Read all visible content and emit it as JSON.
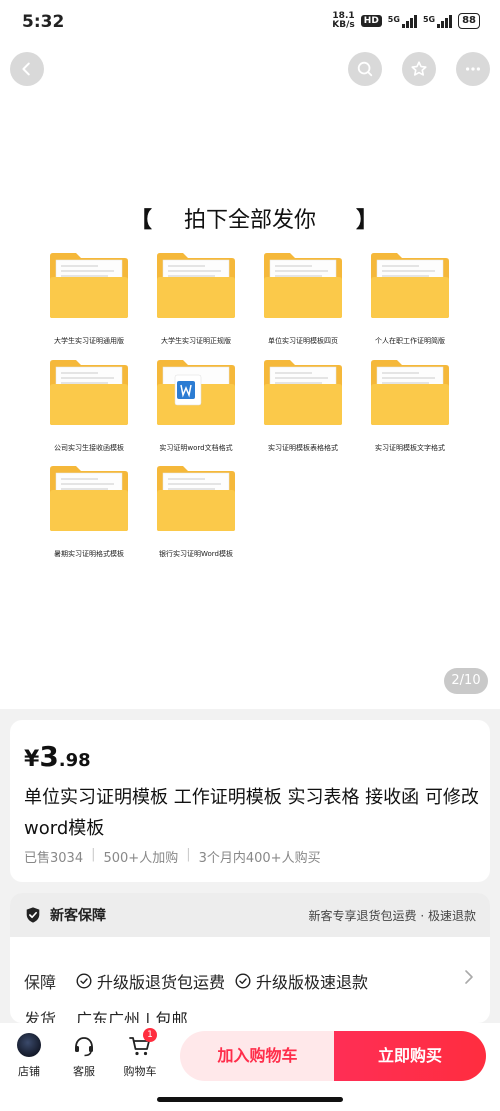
{
  "status_bar": {
    "time": "5:32",
    "net_speed_value": "18.1",
    "net_speed_unit": "KB/s",
    "hd_label": "HD",
    "signal_1": "5G",
    "signal_2": "5G",
    "battery": "88"
  },
  "gallery": {
    "headline": "拍下全部发你",
    "bracket_left": "【",
    "bracket_right": "】",
    "page_indicator": "2/10",
    "folders": [
      {
        "label": "大学生实习证明通用版"
      },
      {
        "label": "大学生实习证明正规版"
      },
      {
        "label": "单位实习证明模板四页"
      },
      {
        "label": "个人在职工作证明简版"
      },
      {
        "label": "公司实习生接收函模板"
      },
      {
        "label": "实习证明word文档格式"
      },
      {
        "label": "实习证明模板表格格式"
      },
      {
        "label": "实习证明模板文字格式"
      },
      {
        "label": "暑期实习证明格式模板"
      },
      {
        "label": "银行实习证明Word模板"
      }
    ]
  },
  "product": {
    "currency": "¥",
    "price_int": "3",
    "price_dec": ".98",
    "title": "单位实习证明模板 工作证明模板 实习表格 接收函 可修改word模板",
    "sold": "已售3034",
    "added": "500+人加购",
    "recent": "3个月内400+人购买"
  },
  "guarantee": {
    "title": "新客保障",
    "right_text": "新客专享退货包运费 · 极速退款",
    "row1_label": "保障",
    "items": [
      "升级版退货包运费",
      "升级版极速退款"
    ],
    "row2_label": "发货",
    "row2_value": "广东广州 | 包邮"
  },
  "bottom_bar": {
    "store": "店铺",
    "service": "客服",
    "cart": "购物车",
    "cart_badge": "1",
    "add_to_cart": "加入购物车",
    "buy_now": "立即购买"
  },
  "colors": {
    "accent": "#ff2d3f",
    "folder_yellow": "#fbc94a",
    "folder_dark": "#f5b83a"
  }
}
